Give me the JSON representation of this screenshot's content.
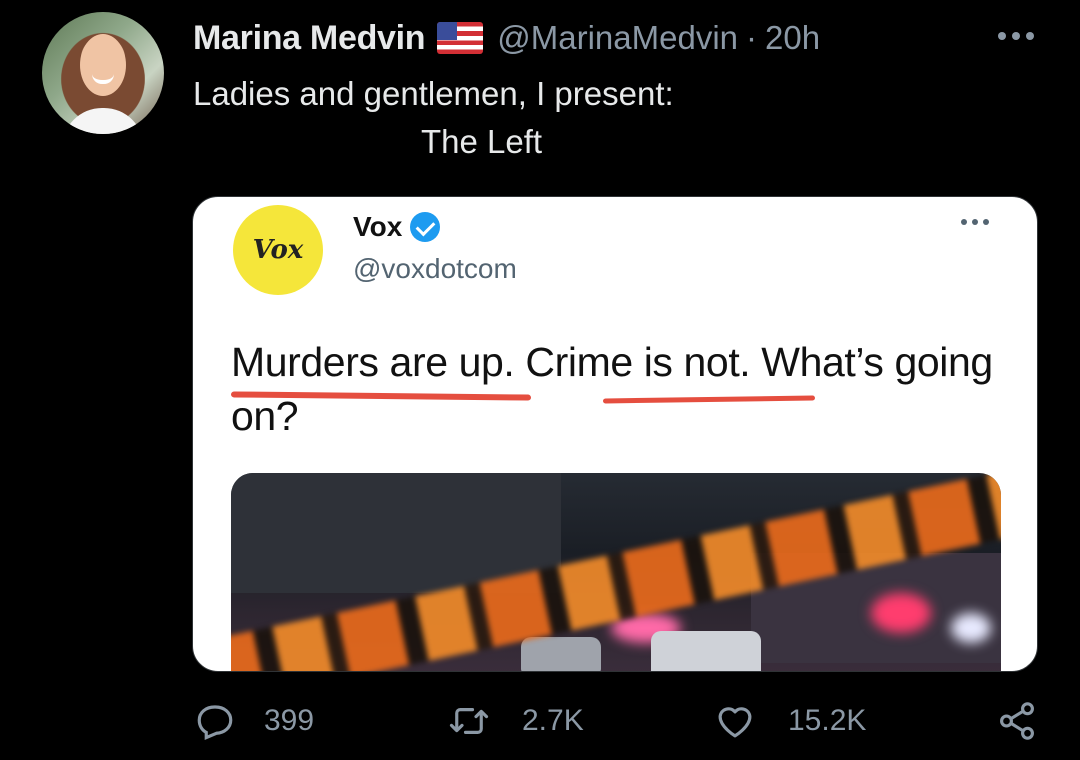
{
  "author": {
    "name": "Marina Medvin",
    "handle": "@MarinaMedvin",
    "separator": "·",
    "time": "20h"
  },
  "tweet": {
    "line1": "Ladies and gentlemen, I present:",
    "line2": "The Left"
  },
  "quoted": {
    "logo_text": "Vox",
    "name": "Vox",
    "handle": "@voxdotcom",
    "headline": "Murders are up. Crime is not. What’s going on?"
  },
  "actions": {
    "replies": "399",
    "retweets": "2.7K",
    "likes": "15.2K"
  },
  "icons": {
    "reply": "speech-bubble-icon",
    "retweet": "retweet-arrows-icon",
    "like": "heart-icon",
    "share": "share-nodes-icon",
    "more": "ellipsis-icon",
    "verified": "verified-badge-icon",
    "flag": "us-flag-icon"
  },
  "colors": {
    "background": "#000000",
    "text": "#e7e9ea",
    "muted": "#8b98a5",
    "verified": "#1d9bf0",
    "underline": "#e23b2a",
    "vox_yellow": "#f5e63a"
  }
}
